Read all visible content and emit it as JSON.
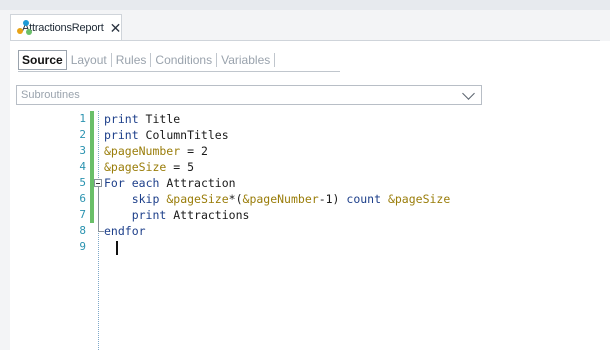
{
  "document_tab": {
    "title": "AttractionsReport",
    "close_glyph": "✕"
  },
  "subtabs": [
    "Source",
    "Layout",
    "Rules",
    "Conditions",
    "Variables"
  ],
  "active_subtab": "Source",
  "combo": {
    "value": "Subroutines"
  },
  "editor": {
    "line_numbers": [
      "1",
      "2",
      "3",
      "4",
      "5",
      "6",
      "7",
      "8",
      "9"
    ],
    "lines": [
      "print Title",
      "print ColumnTitles",
      "&pageNumber = 2",
      "&pageSize = 5",
      "For each Attraction",
      "    skip &pageSize*(&pageNumber-1) count &pageSize",
      "    print Attractions",
      "endfor",
      ""
    ]
  },
  "colors": {
    "keyword": "#1d3f8a",
    "variable": "#9a7d0a",
    "line_number": "#2b93b0",
    "changed_bar": "#6abf69"
  },
  "icons": {
    "tab_icon": "genexus-object-icon",
    "combo_arrow": "chevron-down-icon"
  }
}
